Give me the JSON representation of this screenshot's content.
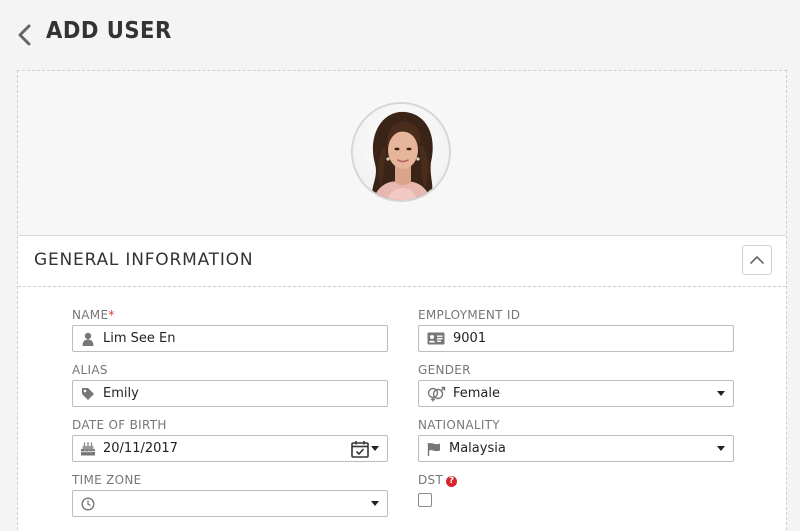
{
  "page": {
    "title": "ADD USER"
  },
  "section": {
    "title": "GENERAL INFORMATION"
  },
  "form": {
    "name": {
      "label": "NAME",
      "required_mark": "*",
      "value": "Lim See En"
    },
    "employment_id": {
      "label": "EMPLOYMENT ID",
      "value": "9001"
    },
    "alias": {
      "label": "ALIAS",
      "value": "Emily"
    },
    "gender": {
      "label": "GENDER",
      "value": "Female"
    },
    "dob": {
      "label": "DATE OF BIRTH",
      "value": "20/11/2017"
    },
    "nationality": {
      "label": "NATIONALITY",
      "value": "Malaysia"
    },
    "time_zone": {
      "label": "TIME ZONE",
      "value": ""
    },
    "dst": {
      "label": "DST",
      "help": "?",
      "checked": false
    }
  },
  "icons": {
    "back": "chevron-left-icon",
    "collapse": "chevron-up-icon",
    "name": "user-icon",
    "employment_id": "id-card-icon",
    "alias": "tag-icon",
    "gender": "gender-icon",
    "dob": "birthday-cake-icon",
    "calendar": "calendar-check-icon",
    "nationality": "flag-icon",
    "time_zone": "clock-icon"
  },
  "colors": {
    "required": "#e03c31",
    "help": "#d9232d",
    "border": "#bdbdbd"
  }
}
